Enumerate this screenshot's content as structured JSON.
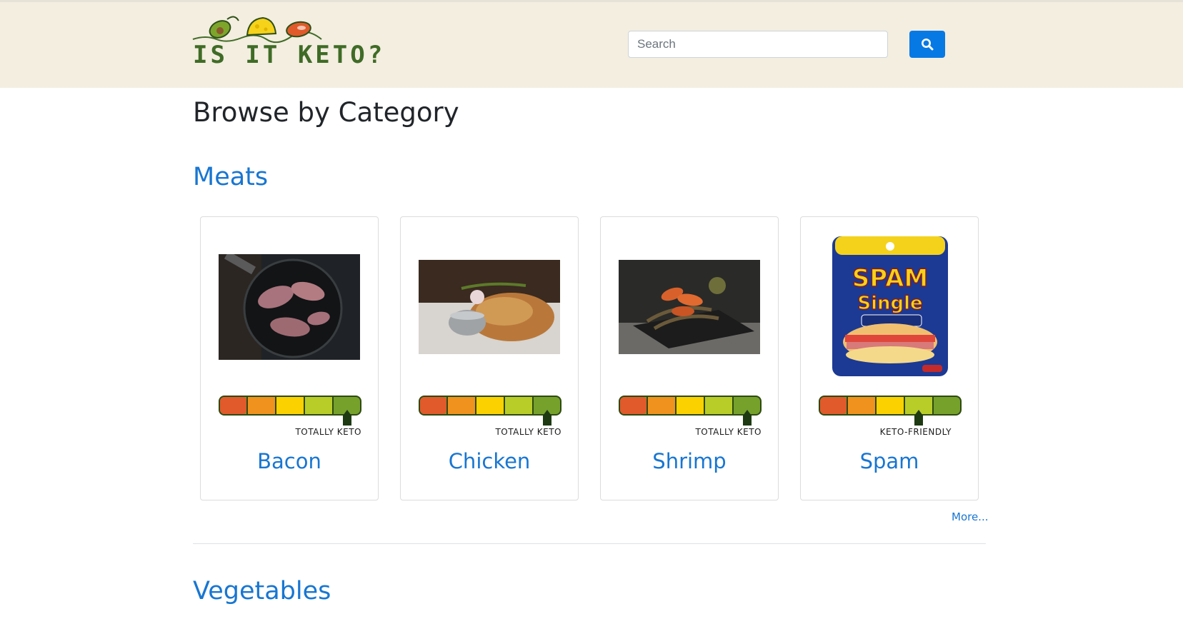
{
  "header": {
    "logo_text": "IS IT KETO?",
    "search": {
      "placeholder": "Search"
    }
  },
  "page_title": "Browse by Category",
  "sections": [
    {
      "title": "Meats",
      "items": [
        {
          "name": "Bacon",
          "rating_label": "TOTALLY KETO",
          "rating_level": 5
        },
        {
          "name": "Chicken",
          "rating_label": "TOTALLY KETO",
          "rating_level": 5
        },
        {
          "name": "Shrimp",
          "rating_label": "TOTALLY KETO",
          "rating_level": 5
        },
        {
          "name": "Spam",
          "rating_label": "KETO-FRIENDLY",
          "rating_level": 4
        }
      ],
      "more_label": "More..."
    },
    {
      "title": "Vegetables"
    }
  ],
  "colors": {
    "header_bg": "#f3eee0",
    "link": "#1876d1",
    "search_button": "#0779e4",
    "meter_segments": [
      "#e05a2b",
      "#f0921e",
      "#fcd100",
      "#b9cd28",
      "#76a12b"
    ]
  }
}
